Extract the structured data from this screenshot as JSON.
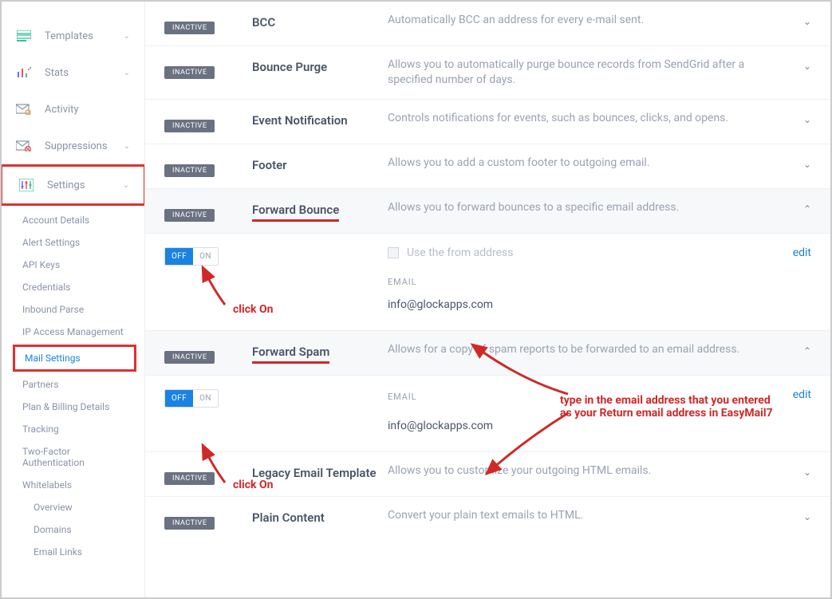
{
  "sidebar": {
    "templates": "Templates",
    "stats": "Stats",
    "activity": "Activity",
    "suppressions": "Suppressions",
    "settings": "Settings",
    "sub": {
      "account_details": "Account Details",
      "alert_settings": "Alert Settings",
      "api_keys": "API Keys",
      "credentials": "Credentials",
      "inbound_parse": "Inbound Parse",
      "ip_access": "IP Access Management",
      "mail_settings": "Mail Settings",
      "partners": "Partners",
      "plan_billing": "Plan & Billing Details",
      "tracking": "Tracking",
      "two_factor": "Two-Factor Authentication",
      "whitelabels": "Whitelabels",
      "overview": "Overview",
      "domains": "Domains",
      "email_links": "Email Links"
    }
  },
  "badges": {
    "inactive": "INACTIVE"
  },
  "toggle": {
    "off": "OFF",
    "on": "ON"
  },
  "rows": {
    "bcc": {
      "title": "BCC",
      "desc": "Automatically BCC an address for every e-mail sent."
    },
    "bounce_purge": {
      "title": "Bounce Purge",
      "desc": "Allows you to automatically purge bounce records from SendGrid after a specified number of days."
    },
    "event_notification": {
      "title": "Event Notification",
      "desc": "Controls notifications for events, such as bounces, clicks, and opens."
    },
    "footer": {
      "title": "Footer",
      "desc": "Allows you to add a custom footer to outgoing email."
    },
    "forward_bounce": {
      "title": "Forward Bounce",
      "desc": "Allows you to forward bounces to a specific email address."
    },
    "forward_spam": {
      "title": "Forward Spam",
      "desc": "Allows for a copy of spam reports to be forwarded to an email address."
    },
    "legacy_template": {
      "title": "Legacy Email Template",
      "desc": "Allows you to customize your outgoing HTML emails."
    },
    "plain_content": {
      "title": "Plain Content",
      "desc": "Convert your plain text emails to HTML."
    }
  },
  "panel": {
    "use_from": "Use the from address",
    "email_label": "EMAIL",
    "email_value": "info@glockapps.com",
    "edit": "edit"
  },
  "annotations": {
    "click_on": "click On",
    "type_line1": "type in the email address that you entered",
    "type_line2": "as your Return email address in EasyMail7"
  }
}
